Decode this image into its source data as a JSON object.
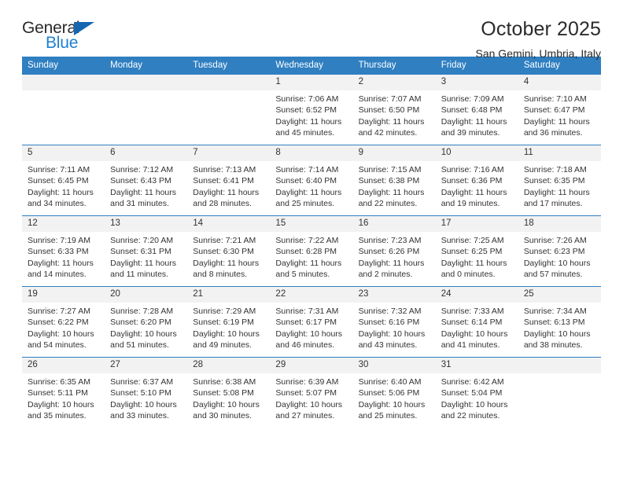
{
  "brand": {
    "name_part1": "General",
    "name_part2": "Blue",
    "triangle_color": "#1565b0",
    "blue_text_color": "#1f7fd0"
  },
  "header": {
    "title": "October 2025",
    "subtitle": "San Gemini, Umbria, Italy"
  },
  "theme": {
    "header_row_bg": "#2f7fc1",
    "daynum_bg": "#f2f2f2",
    "grid_line": "#2f7fc1",
    "text": "#333333"
  },
  "weekdays": [
    "Sunday",
    "Monday",
    "Tuesday",
    "Wednesday",
    "Thursday",
    "Friday",
    "Saturday"
  ],
  "weeks": [
    [
      {
        "day": "",
        "sunrise": "",
        "sunset": "",
        "daylight_line1": "",
        "daylight_line2": ""
      },
      {
        "day": "",
        "sunrise": "",
        "sunset": "",
        "daylight_line1": "",
        "daylight_line2": ""
      },
      {
        "day": "",
        "sunrise": "",
        "sunset": "",
        "daylight_line1": "",
        "daylight_line2": ""
      },
      {
        "day": "1",
        "sunrise": "Sunrise: 7:06 AM",
        "sunset": "Sunset: 6:52 PM",
        "daylight_line1": "Daylight: 11 hours",
        "daylight_line2": "and 45 minutes."
      },
      {
        "day": "2",
        "sunrise": "Sunrise: 7:07 AM",
        "sunset": "Sunset: 6:50 PM",
        "daylight_line1": "Daylight: 11 hours",
        "daylight_line2": "and 42 minutes."
      },
      {
        "day": "3",
        "sunrise": "Sunrise: 7:09 AM",
        "sunset": "Sunset: 6:48 PM",
        "daylight_line1": "Daylight: 11 hours",
        "daylight_line2": "and 39 minutes."
      },
      {
        "day": "4",
        "sunrise": "Sunrise: 7:10 AM",
        "sunset": "Sunset: 6:47 PM",
        "daylight_line1": "Daylight: 11 hours",
        "daylight_line2": "and 36 minutes."
      }
    ],
    [
      {
        "day": "5",
        "sunrise": "Sunrise: 7:11 AM",
        "sunset": "Sunset: 6:45 PM",
        "daylight_line1": "Daylight: 11 hours",
        "daylight_line2": "and 34 minutes."
      },
      {
        "day": "6",
        "sunrise": "Sunrise: 7:12 AM",
        "sunset": "Sunset: 6:43 PM",
        "daylight_line1": "Daylight: 11 hours",
        "daylight_line2": "and 31 minutes."
      },
      {
        "day": "7",
        "sunrise": "Sunrise: 7:13 AM",
        "sunset": "Sunset: 6:41 PM",
        "daylight_line1": "Daylight: 11 hours",
        "daylight_line2": "and 28 minutes."
      },
      {
        "day": "8",
        "sunrise": "Sunrise: 7:14 AM",
        "sunset": "Sunset: 6:40 PM",
        "daylight_line1": "Daylight: 11 hours",
        "daylight_line2": "and 25 minutes."
      },
      {
        "day": "9",
        "sunrise": "Sunrise: 7:15 AM",
        "sunset": "Sunset: 6:38 PM",
        "daylight_line1": "Daylight: 11 hours",
        "daylight_line2": "and 22 minutes."
      },
      {
        "day": "10",
        "sunrise": "Sunrise: 7:16 AM",
        "sunset": "Sunset: 6:36 PM",
        "daylight_line1": "Daylight: 11 hours",
        "daylight_line2": "and 19 minutes."
      },
      {
        "day": "11",
        "sunrise": "Sunrise: 7:18 AM",
        "sunset": "Sunset: 6:35 PM",
        "daylight_line1": "Daylight: 11 hours",
        "daylight_line2": "and 17 minutes."
      }
    ],
    [
      {
        "day": "12",
        "sunrise": "Sunrise: 7:19 AM",
        "sunset": "Sunset: 6:33 PM",
        "daylight_line1": "Daylight: 11 hours",
        "daylight_line2": "and 14 minutes."
      },
      {
        "day": "13",
        "sunrise": "Sunrise: 7:20 AM",
        "sunset": "Sunset: 6:31 PM",
        "daylight_line1": "Daylight: 11 hours",
        "daylight_line2": "and 11 minutes."
      },
      {
        "day": "14",
        "sunrise": "Sunrise: 7:21 AM",
        "sunset": "Sunset: 6:30 PM",
        "daylight_line1": "Daylight: 11 hours",
        "daylight_line2": "and 8 minutes."
      },
      {
        "day": "15",
        "sunrise": "Sunrise: 7:22 AM",
        "sunset": "Sunset: 6:28 PM",
        "daylight_line1": "Daylight: 11 hours",
        "daylight_line2": "and 5 minutes."
      },
      {
        "day": "16",
        "sunrise": "Sunrise: 7:23 AM",
        "sunset": "Sunset: 6:26 PM",
        "daylight_line1": "Daylight: 11 hours",
        "daylight_line2": "and 2 minutes."
      },
      {
        "day": "17",
        "sunrise": "Sunrise: 7:25 AM",
        "sunset": "Sunset: 6:25 PM",
        "daylight_line1": "Daylight: 11 hours",
        "daylight_line2": "and 0 minutes."
      },
      {
        "day": "18",
        "sunrise": "Sunrise: 7:26 AM",
        "sunset": "Sunset: 6:23 PM",
        "daylight_line1": "Daylight: 10 hours",
        "daylight_line2": "and 57 minutes."
      }
    ],
    [
      {
        "day": "19",
        "sunrise": "Sunrise: 7:27 AM",
        "sunset": "Sunset: 6:22 PM",
        "daylight_line1": "Daylight: 10 hours",
        "daylight_line2": "and 54 minutes."
      },
      {
        "day": "20",
        "sunrise": "Sunrise: 7:28 AM",
        "sunset": "Sunset: 6:20 PM",
        "daylight_line1": "Daylight: 10 hours",
        "daylight_line2": "and 51 minutes."
      },
      {
        "day": "21",
        "sunrise": "Sunrise: 7:29 AM",
        "sunset": "Sunset: 6:19 PM",
        "daylight_line1": "Daylight: 10 hours",
        "daylight_line2": "and 49 minutes."
      },
      {
        "day": "22",
        "sunrise": "Sunrise: 7:31 AM",
        "sunset": "Sunset: 6:17 PM",
        "daylight_line1": "Daylight: 10 hours",
        "daylight_line2": "and 46 minutes."
      },
      {
        "day": "23",
        "sunrise": "Sunrise: 7:32 AM",
        "sunset": "Sunset: 6:16 PM",
        "daylight_line1": "Daylight: 10 hours",
        "daylight_line2": "and 43 minutes."
      },
      {
        "day": "24",
        "sunrise": "Sunrise: 7:33 AM",
        "sunset": "Sunset: 6:14 PM",
        "daylight_line1": "Daylight: 10 hours",
        "daylight_line2": "and 41 minutes."
      },
      {
        "day": "25",
        "sunrise": "Sunrise: 7:34 AM",
        "sunset": "Sunset: 6:13 PM",
        "daylight_line1": "Daylight: 10 hours",
        "daylight_line2": "and 38 minutes."
      }
    ],
    [
      {
        "day": "26",
        "sunrise": "Sunrise: 6:35 AM",
        "sunset": "Sunset: 5:11 PM",
        "daylight_line1": "Daylight: 10 hours",
        "daylight_line2": "and 35 minutes."
      },
      {
        "day": "27",
        "sunrise": "Sunrise: 6:37 AM",
        "sunset": "Sunset: 5:10 PM",
        "daylight_line1": "Daylight: 10 hours",
        "daylight_line2": "and 33 minutes."
      },
      {
        "day": "28",
        "sunrise": "Sunrise: 6:38 AM",
        "sunset": "Sunset: 5:08 PM",
        "daylight_line1": "Daylight: 10 hours",
        "daylight_line2": "and 30 minutes."
      },
      {
        "day": "29",
        "sunrise": "Sunrise: 6:39 AM",
        "sunset": "Sunset: 5:07 PM",
        "daylight_line1": "Daylight: 10 hours",
        "daylight_line2": "and 27 minutes."
      },
      {
        "day": "30",
        "sunrise": "Sunrise: 6:40 AM",
        "sunset": "Sunset: 5:06 PM",
        "daylight_line1": "Daylight: 10 hours",
        "daylight_line2": "and 25 minutes."
      },
      {
        "day": "31",
        "sunrise": "Sunrise: 6:42 AM",
        "sunset": "Sunset: 5:04 PM",
        "daylight_line1": "Daylight: 10 hours",
        "daylight_line2": "and 22 minutes."
      },
      {
        "day": "",
        "sunrise": "",
        "sunset": "",
        "daylight_line1": "",
        "daylight_line2": ""
      }
    ]
  ]
}
